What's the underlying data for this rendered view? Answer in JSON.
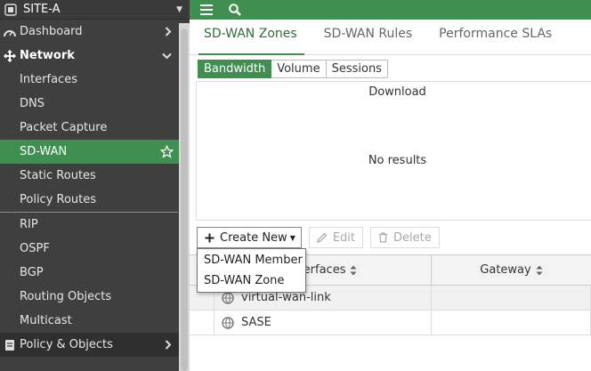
{
  "site": {
    "name": "SITE-A"
  },
  "sidebar": {
    "items": [
      {
        "label": "Dashboard",
        "icon": "dashboard-icon",
        "top": true,
        "expand": "chevron-right"
      },
      {
        "label": "Network",
        "icon": "network-icon",
        "top": true,
        "expand": "chevron-down",
        "bold": true
      },
      {
        "label": "Interfaces"
      },
      {
        "label": "DNS"
      },
      {
        "label": "Packet Capture"
      },
      {
        "label": "SD-WAN",
        "active": true,
        "favorite": true
      },
      {
        "label": "Static Routes"
      },
      {
        "label": "Policy Routes"
      },
      {
        "label": "RIP"
      },
      {
        "label": "OSPF"
      },
      {
        "label": "BGP"
      },
      {
        "label": "Routing Objects"
      },
      {
        "label": "Multicast"
      },
      {
        "label": "Policy & Objects",
        "icon": "policy-icon",
        "top": true,
        "expand": "chevron-right"
      }
    ]
  },
  "topbar": {
    "icons": [
      "menu-icon",
      "search-icon"
    ]
  },
  "tabs": [
    {
      "label": "SD-WAN Zones",
      "active": true
    },
    {
      "label": "SD-WAN Rules"
    },
    {
      "label": "Performance SLAs"
    }
  ],
  "segments": [
    {
      "label": "Bandwidth",
      "active": true
    },
    {
      "label": "Volume"
    },
    {
      "label": "Sessions"
    }
  ],
  "chart": {
    "title": "Download",
    "empty_text": "No results"
  },
  "toolbar": {
    "create_label": "Create New",
    "edit_label": "Edit",
    "delete_label": "Delete"
  },
  "table": {
    "columns": [
      "Interfaces",
      "Gateway"
    ],
    "rows": [
      {
        "interface": "virtual-wan-link",
        "gateway": ""
      },
      {
        "interface": "SASE",
        "gateway": ""
      }
    ]
  },
  "dropdown": {
    "items": [
      "SD-WAN Member",
      "SD-WAN Zone"
    ]
  },
  "colors": {
    "accent": "#3f8f50",
    "sidebar_bg": "#3f3f3f"
  }
}
